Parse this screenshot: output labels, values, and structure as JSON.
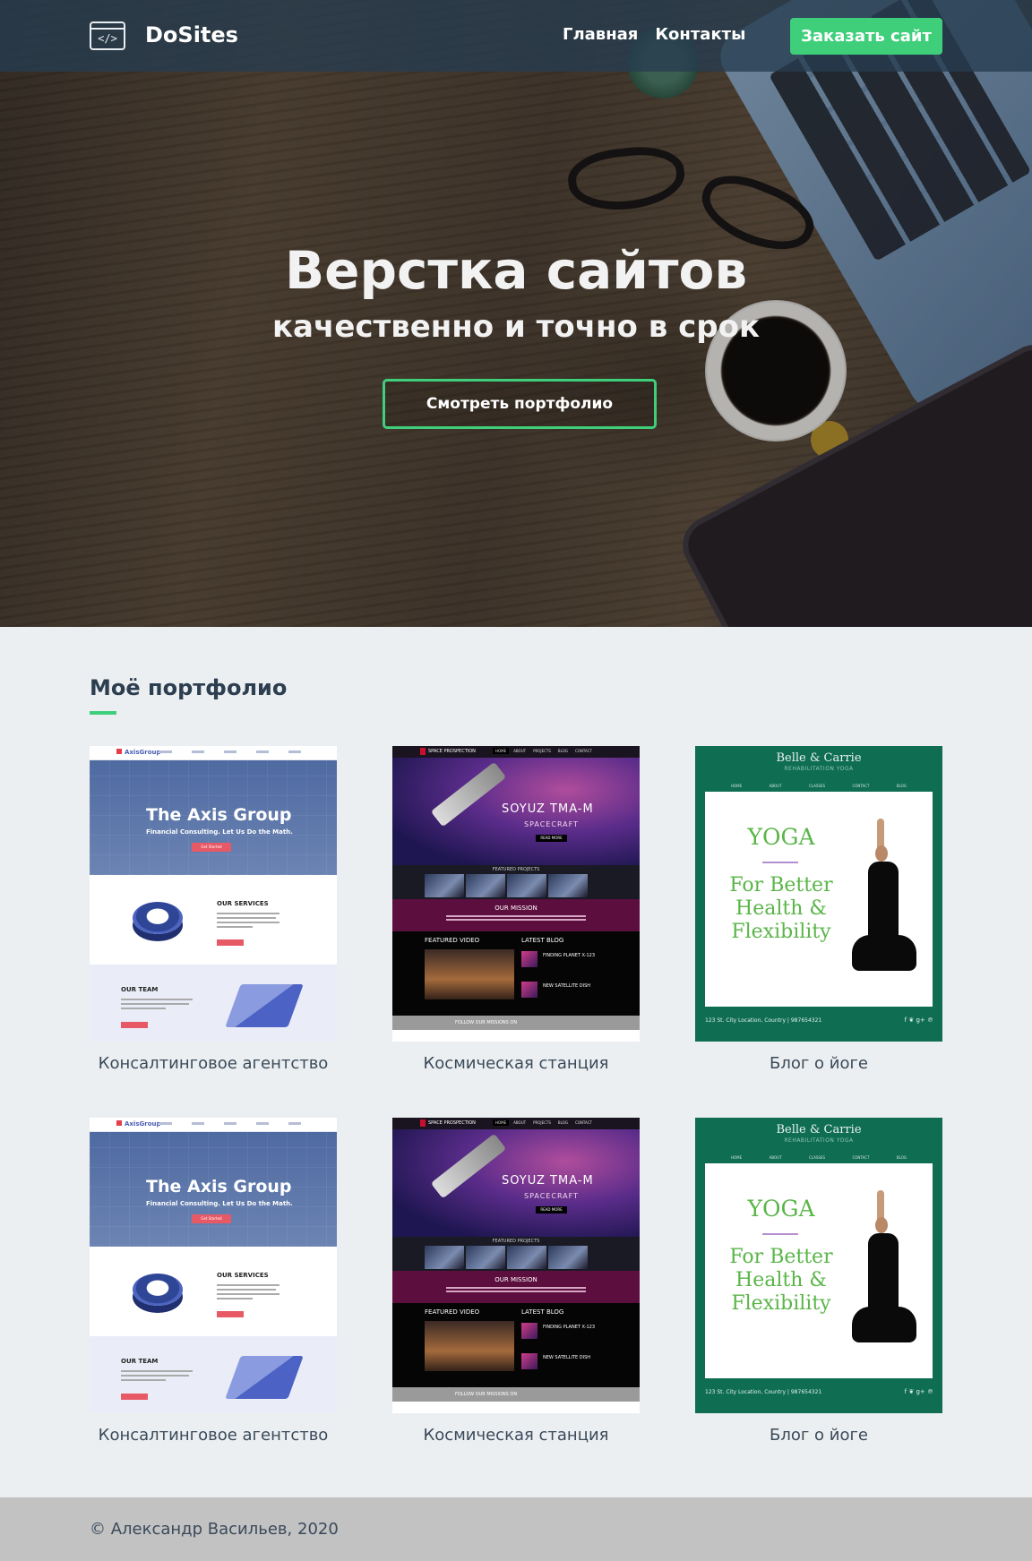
{
  "navbar": {
    "logo_icon": "code-window-icon",
    "logo_glyph": "</>",
    "brand": "DoSites",
    "links": [
      "Главная",
      "Контакты"
    ],
    "order_button": "Заказать сайт"
  },
  "hero": {
    "title": "Верстка сайтов",
    "subtitle": "качественно и точно в срок",
    "cta_button": "Смотреть портфолио"
  },
  "portfolio": {
    "title": "Моё портфолио",
    "items": [
      {
        "caption": "Консалтинговое агентство",
        "type": "axis"
      },
      {
        "caption": "Космическая станция",
        "type": "space"
      },
      {
        "caption": "Блог о йоге",
        "type": "yoga"
      },
      {
        "caption": "Консалтинговое агентство",
        "type": "axis"
      },
      {
        "caption": "Космическая станция",
        "type": "space"
      },
      {
        "caption": "Блог о йоге",
        "type": "yoga"
      }
    ]
  },
  "thumb_axis": {
    "logo": "AxisGroup",
    "title": "The Axis Group",
    "subtitle": "Financial Consulting.  Let Us Do the Math.",
    "button": "Get Started",
    "services": "OUR SERVICES",
    "team": "OUR TEAM"
  },
  "thumb_space": {
    "logo": "SPACE PROSPECTION",
    "nav": [
      "HOME",
      "ABOUT",
      "PROJECTS",
      "BLOG",
      "CONTACT"
    ],
    "title": "SOYUZ TMA-M",
    "subtitle": "SPACECRAFT",
    "read_more": "READ MORE",
    "featured": "FEATURED PROJECTS",
    "mission": "OUR MISSION",
    "video": "FEATURED VIDEO",
    "blog": "LATEST BLOG",
    "post1": "FINDING PLANET X-123",
    "post2": "NEW SATELLITE DISH",
    "follow": "FOLLOW OUR MISSIONS ON"
  },
  "thumb_yoga": {
    "title": "Belle & Carrie",
    "subtitle": "REHABILITATION YOGA",
    "nav": [
      "HOME",
      "ABOUT",
      "CLASSES",
      "CONTACT",
      "BLOG"
    ],
    "word": "YOGA",
    "slogan": "For Better Health & Flexibility",
    "footer": "123 St. City Location, Country | 987654321",
    "social": "f ❦ g+ ℗"
  },
  "footer": {
    "copyright": "© Александр Васильев, 2020"
  },
  "colors": {
    "accent": "#3fcf7b",
    "navbar": "#263c50",
    "heading": "#2c3e50",
    "footer_bg": "#c2c2c2"
  }
}
